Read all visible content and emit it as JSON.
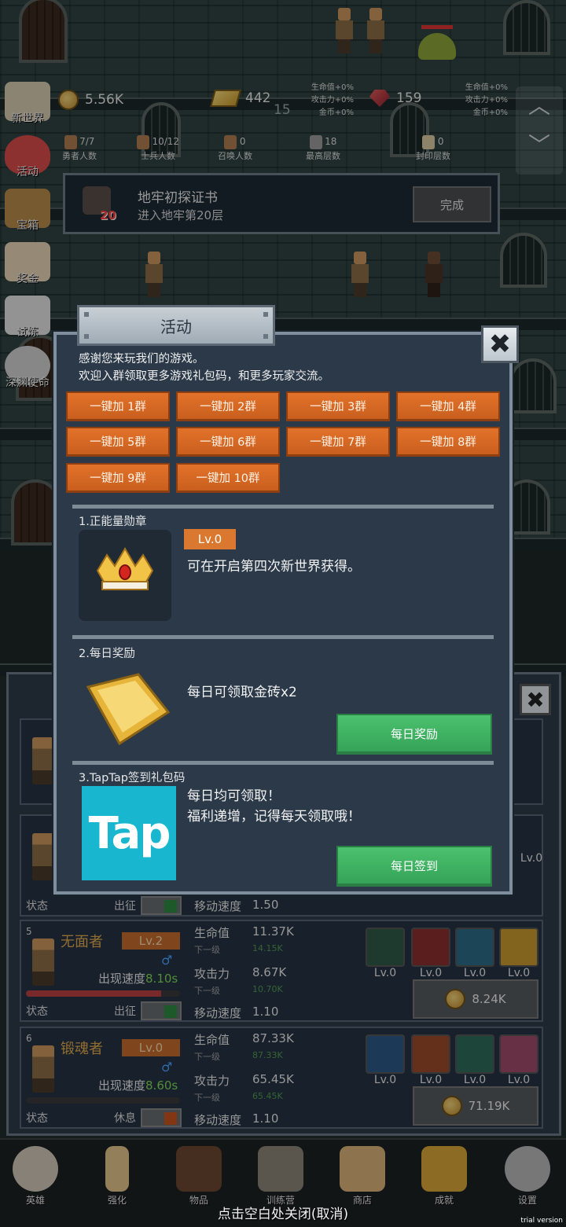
{
  "hud": {
    "gold": "5.56K",
    "gold_bars": "442",
    "floor_now": "15",
    "gems": "159",
    "bonus_left": [
      "生命值+0%",
      "攻击力+0%",
      "金币+0%"
    ],
    "bonus_right": [
      "生命值+0%",
      "攻击力+0%",
      "金币+0%"
    ],
    "stats": [
      {
        "value": "7/7",
        "label": "勇者人数"
      },
      {
        "value": "10/12",
        "label": "士兵人数"
      },
      {
        "value": "0",
        "label": "召唤人数"
      },
      {
        "value": "18",
        "label": "最高层数"
      },
      {
        "value": "0",
        "label": "封印层数"
      }
    ]
  },
  "side_menu": [
    "新世界",
    "活动",
    "宝箱",
    "奖金",
    "试炼",
    "深渊使命"
  ],
  "quest": {
    "title": "地牢初探证书",
    "desc": "进入地牢第20层",
    "badge": "20",
    "button": "完成"
  },
  "modal": {
    "title": "活动",
    "close": "✖",
    "intro_line1": "感谢您来玩我们的游戏。",
    "intro_line2": "欢迎入群领取更多游戏礼包码，和更多玩家交流。",
    "groups": [
      "一键加 1群",
      "一键加 2群",
      "一键加 3群",
      "一键加 4群",
      "一键加 5群",
      "一键加 6群",
      "一键加 7群",
      "一键加 8群",
      "一键加 9群",
      "一键加 10群"
    ],
    "section1": {
      "title": "1.正能量勋章",
      "level": "Lv.0",
      "desc": "可在开启第四次新世界获得。"
    },
    "section2": {
      "title": "2.每日奖励",
      "desc": "每日可领取金砖x2",
      "button": "每日奖励"
    },
    "section3": {
      "title": "3.TapTap签到礼包码",
      "logo": "Tap",
      "desc_line1": "每日均可领取！",
      "desc_line2": "福利递增，记得每天领取哦！",
      "button": "每日签到"
    }
  },
  "heroes": {
    "close": "✖",
    "partial_row": {
      "state_label": "状态",
      "action": "出征",
      "speed_label": "移动速度",
      "speed": "1.50",
      "eq_level": "Lv.0"
    },
    "rows": [
      {
        "index": "5",
        "name": "无面者",
        "level": "Lv.2",
        "gender": "♂",
        "spawn_label": "出现速度",
        "spawn": "8.10s",
        "hp_label": "生命值",
        "hp": "11.37K",
        "next_label": "下一级",
        "hp_next": "14.15K",
        "atk_label": "攻击力",
        "atk": "8.67K",
        "atk_next": "10.70K",
        "speed_label": "移动速度",
        "speed": "1.10",
        "state_label": "状态",
        "action": "出征",
        "hp_fill": 0.88,
        "equip_levels": [
          "Lv.0",
          "Lv.0",
          "Lv.0",
          "Lv.0"
        ],
        "cost": "8.24K",
        "toggle_color": "#2f8a3f"
      },
      {
        "index": "6",
        "name": "锻魂者",
        "level": "Lv.0",
        "gender": "♂",
        "spawn_label": "出现速度",
        "spawn": "8.60s",
        "hp_label": "生命值",
        "hp": "87.33K",
        "next_label": "下一级",
        "hp_next": "87.33K",
        "atk_label": "攻击力",
        "atk": "65.45K",
        "atk_next": "65.45K",
        "speed_label": "移动速度",
        "speed": "1.10",
        "state_label": "状态",
        "action": "休息",
        "hp_fill": 0.0,
        "equip_levels": [
          "Lv.0",
          "Lv.0",
          "Lv.0",
          "Lv.0"
        ],
        "cost": "71.19K",
        "toggle_color": "#c9541f"
      }
    ]
  },
  "nav": [
    "英雄",
    "强化",
    "物品",
    "训练营",
    "商店",
    "成就",
    "设置"
  ],
  "close_hint": "点击空白处关闭(取消)",
  "watermark": "trial version",
  "colors": {
    "orange_button": "#e2722a",
    "green_button": "#4cc16e",
    "modal_bg": "#2b3949",
    "tap_brand": "#19b7cf"
  }
}
